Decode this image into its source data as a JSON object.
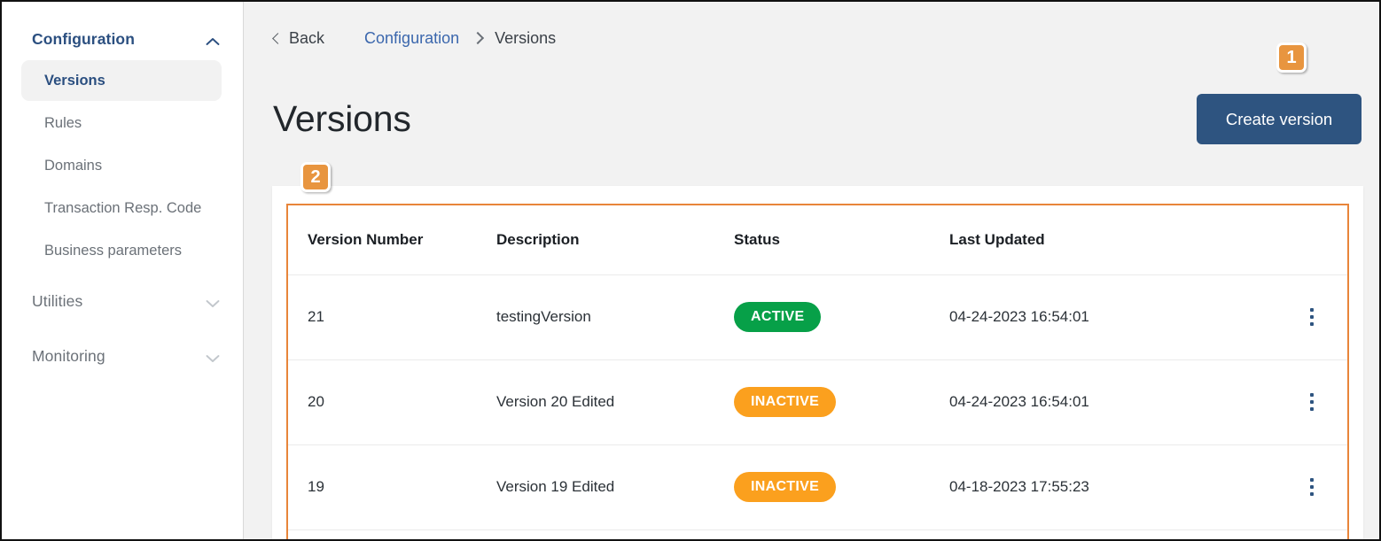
{
  "sidebar": {
    "groups": [
      {
        "label": "Configuration",
        "expanded": true,
        "chevron": "chevron-up-icon",
        "items": [
          {
            "label": "Versions",
            "active": true
          },
          {
            "label": "Rules",
            "active": false
          },
          {
            "label": "Domains",
            "active": false
          },
          {
            "label": "Transaction Resp. Code",
            "active": false
          },
          {
            "label": "Business parameters",
            "active": false
          }
        ]
      },
      {
        "label": "Utilities",
        "expanded": false,
        "chevron": "chevron-down-icon",
        "items": []
      },
      {
        "label": "Monitoring",
        "expanded": false,
        "chevron": "chevron-down-icon",
        "items": []
      }
    ]
  },
  "breadcrumb": {
    "back_label": "Back",
    "back_icon": "chevron-left-icon",
    "link_label": "Configuration",
    "separator_icon": "chevron-right-icon",
    "current_label": "Versions"
  },
  "page": {
    "title": "Versions"
  },
  "toolbar": {
    "create_label": "Create version"
  },
  "annotations": {
    "badge_1": "1",
    "badge_2": "2"
  },
  "table": {
    "columns": [
      "Version Number",
      "Description",
      "Status",
      "Last Updated",
      ""
    ],
    "rows": [
      {
        "version": "21",
        "description": "testingVersion",
        "status": "ACTIVE",
        "status_kind": "active",
        "last_updated": "04-24-2023 16:54:01",
        "menu_icon": "kebab-menu-icon"
      },
      {
        "version": "20",
        "description": "Version 20 Edited",
        "status": "INACTIVE",
        "status_kind": "inactive",
        "last_updated": "04-24-2023 16:54:01",
        "menu_icon": "kebab-menu-icon"
      },
      {
        "version": "19",
        "description": "Version 19 Edited",
        "status": "INACTIVE",
        "status_kind": "inactive",
        "last_updated": "04-18-2023 17:55:23",
        "menu_icon": "kebab-menu-icon"
      }
    ]
  },
  "colors": {
    "accent_blue": "#2e5480",
    "link_blue": "#3b67ad",
    "status_active": "#07a048",
    "status_inactive": "#fba01e",
    "annotation_orange": "#e8953f",
    "highlight_border": "#e8853a",
    "page_background": "#f2f2f2"
  }
}
